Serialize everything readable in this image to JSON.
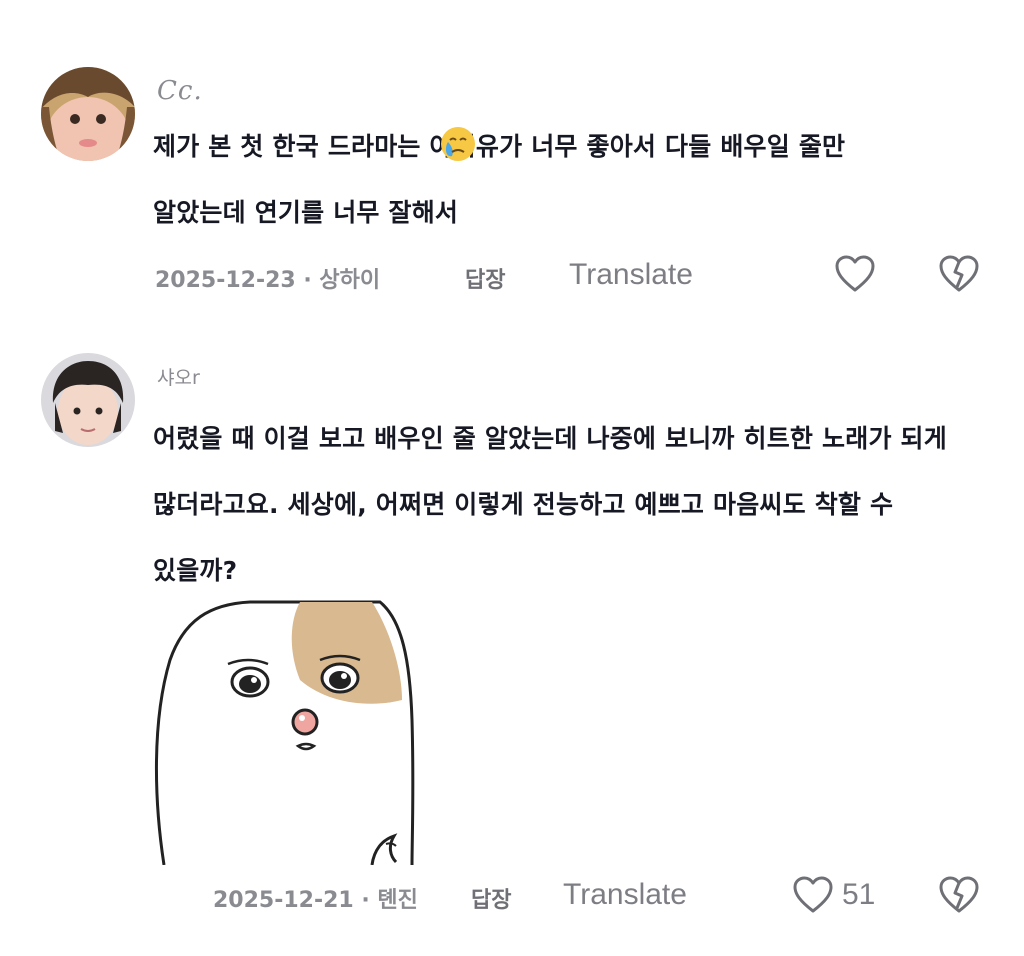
{
  "comments": [
    {
      "username": "Cc.",
      "text_lines": [
        "제가 본 첫 한국 드라마는 아이유가 너무 좋아서 다들 배우일 줄만",
        "알았는데 연기를 너무 잘해서"
      ],
      "date": "2025-12-23 · 상하이",
      "reply_label": "답장",
      "translate_label": "Translate",
      "like_icon": "heart-outline-icon",
      "dislike_icon": "broken-heart-icon",
      "inline_emoji": "crying-emoji-icon"
    },
    {
      "username": "샤오r",
      "text_lines": [
        "어렸을 때 이걸 보고 배우인 줄 알았는데 나중에 보니까 히트한 노래가 되게",
        "많더라고요. 세상에, 어쩌면 이렇게 전능하고 예쁘고 마음씨도 착할 수",
        "있을까?"
      ],
      "date": "2025-12-21 · 톈진",
      "reply_label": "답장",
      "translate_label": "Translate",
      "like_count": "51",
      "like_icon": "heart-outline-icon",
      "dislike_icon": "broken-heart-icon",
      "sticker": "teary-eyed-blob-sticker"
    }
  ],
  "colors": {
    "text_primary": "#161823",
    "text_secondary": "#8a8b91",
    "icon": "#6f7076",
    "sticker_patch": "#d9b98f"
  }
}
